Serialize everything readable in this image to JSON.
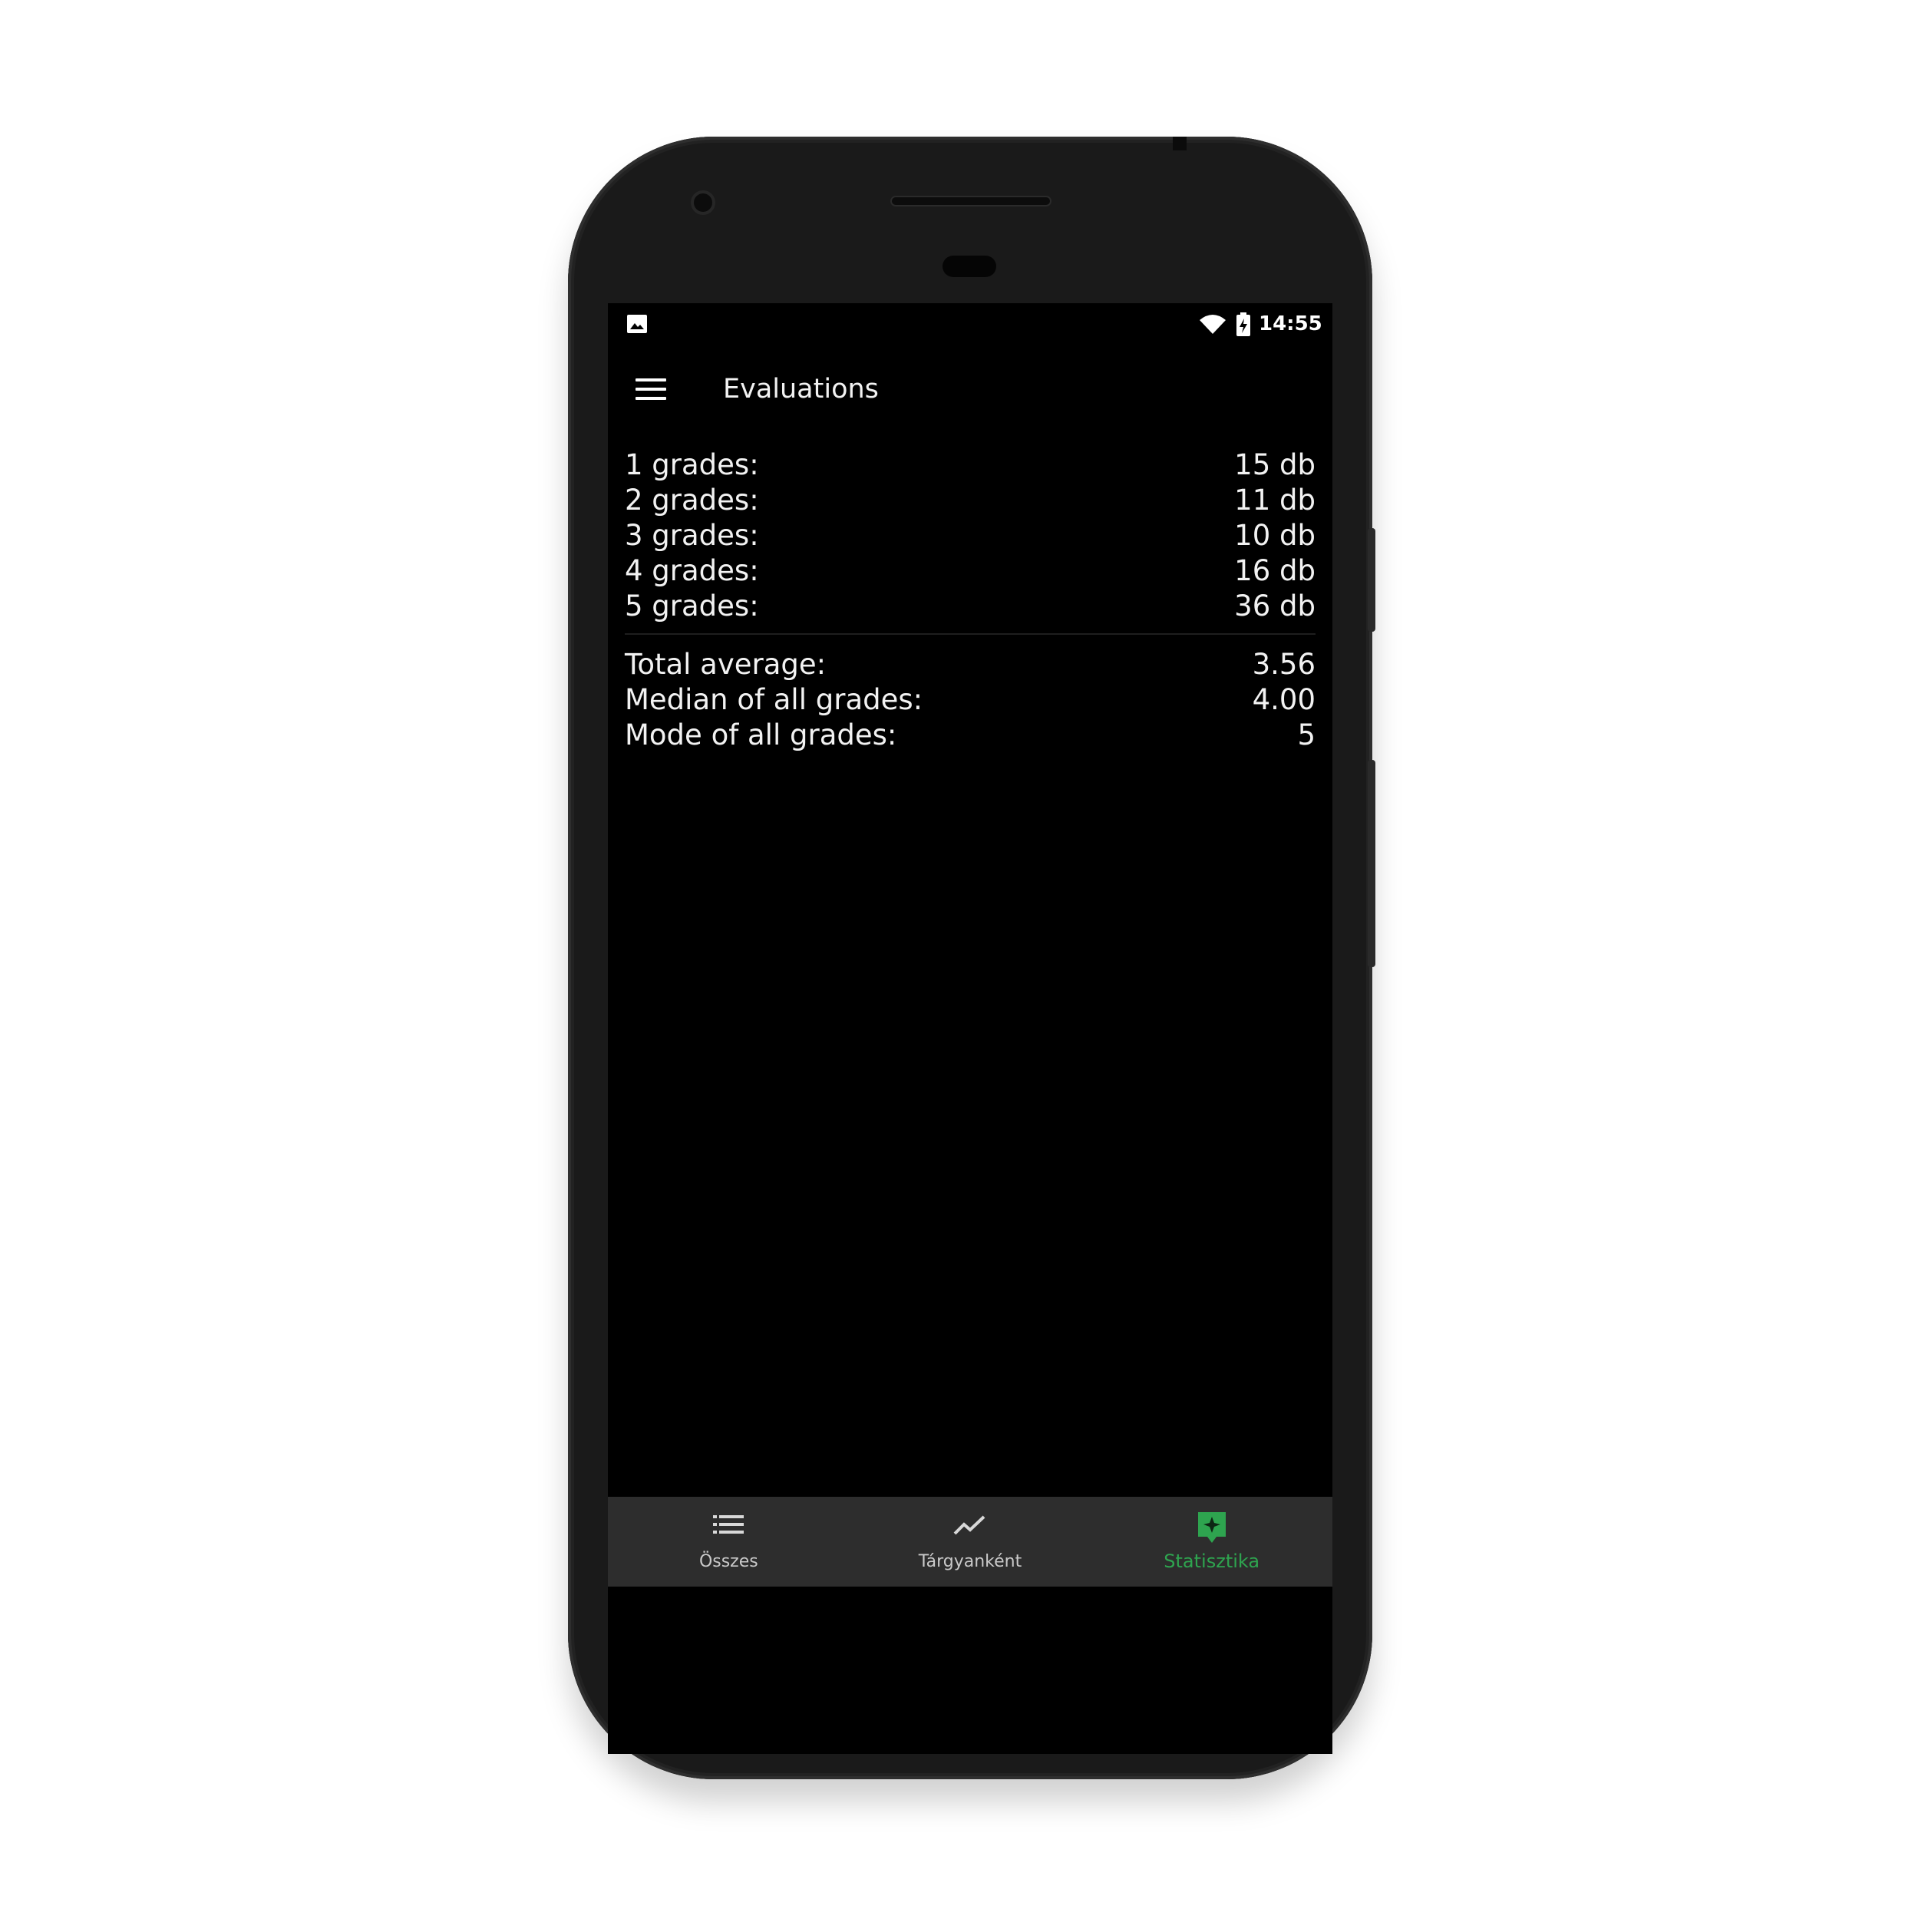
{
  "status_bar": {
    "time": "14:55"
  },
  "app_bar": {
    "title": "Evaluations"
  },
  "grade_counts": [
    {
      "label": "1 grades:",
      "value": "15 db"
    },
    {
      "label": "2 grades:",
      "value": "11 db"
    },
    {
      "label": "3 grades:",
      "value": "10 db"
    },
    {
      "label": "4 grades:",
      "value": "16 db"
    },
    {
      "label": "5 grades:",
      "value": "36 db"
    }
  ],
  "summary": [
    {
      "label": "Total average:",
      "value": "3.56"
    },
    {
      "label": "Median of all grades:",
      "value": "4.00"
    },
    {
      "label": "Mode of all grades:",
      "value": "5"
    }
  ],
  "bottom_nav": [
    {
      "label": "Összes",
      "icon": "list-icon",
      "active": false
    },
    {
      "label": "Tárgyanként",
      "icon": "trending-icon",
      "active": false
    },
    {
      "label": "Statisztika",
      "icon": "stats-icon",
      "active": true
    }
  ],
  "colors": {
    "accent": "#2ea44f",
    "background": "#000000",
    "nav_background": "#2d2d2d"
  }
}
